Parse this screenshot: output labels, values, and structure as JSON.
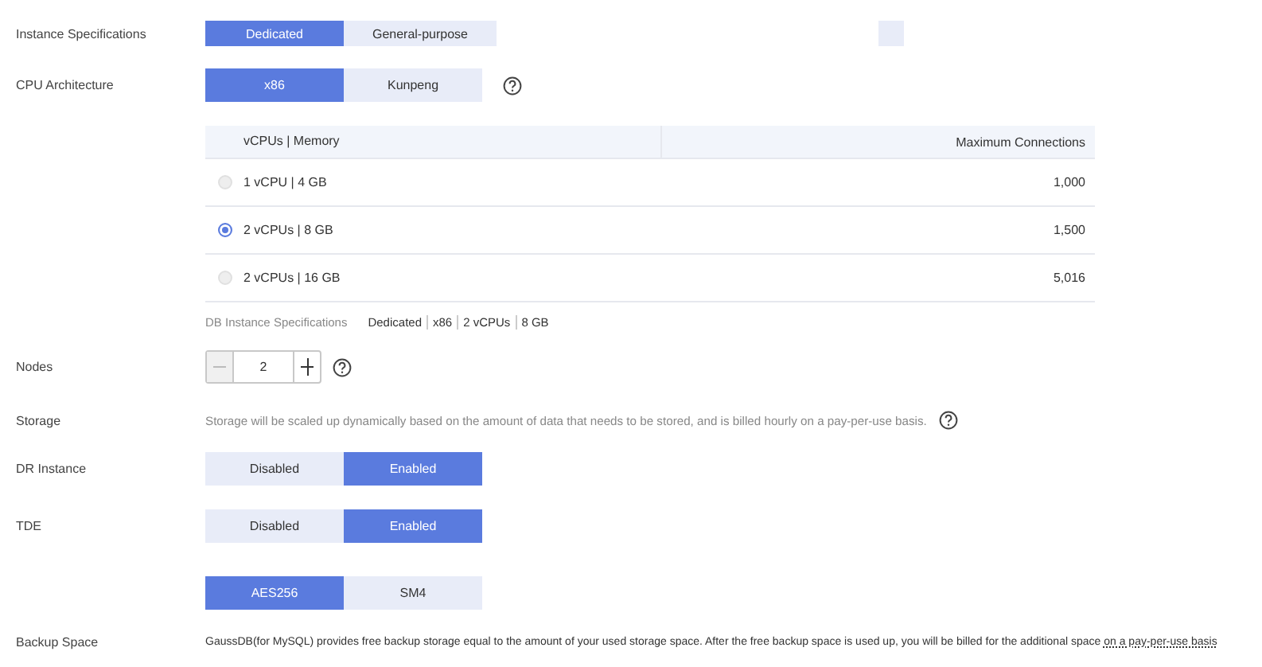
{
  "instance_specifications": {
    "label": "Instance Specifications",
    "options": [
      {
        "label": "Dedicated",
        "selected": true
      },
      {
        "label": "General-purpose",
        "selected": false
      }
    ]
  },
  "cpu_architecture": {
    "label": "CPU Architecture",
    "options": [
      {
        "label": "x86",
        "selected": true
      },
      {
        "label": "Kunpeng",
        "selected": false
      }
    ]
  },
  "spec_table": {
    "columns": [
      "vCPUs | Memory",
      "Maximum Connections"
    ],
    "rows": [
      {
        "memory": "1 vCPU | 4 GB",
        "connections": "1,000",
        "selected": false
      },
      {
        "memory": "2 vCPUs | 8 GB",
        "connections": "1,500",
        "selected": true
      },
      {
        "memory": "2 vCPUs | 16 GB",
        "connections": "5,016",
        "selected": false
      }
    ]
  },
  "summary": {
    "label": "DB Instance Specifications",
    "values": [
      "Dedicated",
      "x86",
      "2 vCPUs",
      "8 GB"
    ]
  },
  "nodes": {
    "label": "Nodes",
    "value": "2",
    "minus_disabled": true
  },
  "storage": {
    "label": "Storage",
    "note": "Storage will be scaled up dynamically based on the amount of data that needs to be stored, and is billed hourly on a pay-per-use basis."
  },
  "dr_instance": {
    "label": "DR Instance",
    "options": [
      {
        "label": "Disabled",
        "selected": false
      },
      {
        "label": "Enabled",
        "selected": true
      }
    ]
  },
  "tde": {
    "label": "TDE",
    "options": [
      {
        "label": "Disabled",
        "selected": false
      },
      {
        "label": "Enabled",
        "selected": true
      }
    ]
  },
  "encryption_algorithm": {
    "options": [
      {
        "label": "AES256",
        "selected": true
      },
      {
        "label": "SM4",
        "selected": false
      }
    ]
  },
  "backup_space": {
    "label": "Backup Space",
    "text": "GaussDB(for MySQL) provides free backup storage equal to the amount of your used storage space. After the free backup space is used up, you will be billed for the additional space",
    "link": "on a pay-per-use basis"
  }
}
